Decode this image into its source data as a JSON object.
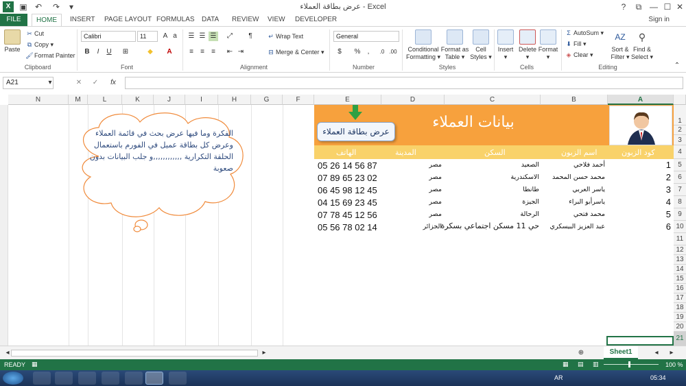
{
  "window": {
    "title": "عرض بطاقة العملاء - Excel",
    "controls": [
      "?",
      "⧉",
      "—",
      "☐",
      "✕"
    ]
  },
  "tabs": [
    "FILE",
    "HOME",
    "INSERT",
    "PAGE LAYOUT",
    "FORMULAS",
    "DATA",
    "REVIEW",
    "VIEW",
    "DEVELOPER"
  ],
  "signin": "Sign in",
  "ribbon": {
    "clipboard": {
      "paste": "Paste",
      "cut": "Cut",
      "copy": "Copy",
      "format_painter": "Format Painter",
      "label": "Clipboard"
    },
    "font": {
      "name": "Calibri",
      "size": "11",
      "label": "Font"
    },
    "alignment": {
      "wrap": "Wrap Text",
      "merge": "Merge & Center",
      "label": "Alignment"
    },
    "number": {
      "format": "General",
      "label": "Number"
    },
    "styles": {
      "conditional": "Conditional",
      "formatting": "Formatting",
      "format_as": "Format as",
      "table": "Table",
      "cell": "Cell",
      "cell_styles": "Styles",
      "label": "Styles"
    },
    "cells": {
      "insert": "Insert",
      "delete": "Delete",
      "format": "Format",
      "label": "Cells"
    },
    "editing": {
      "autosum": "AutoSum",
      "fill": "Fill",
      "clear": "Clear",
      "sort": "Sort &",
      "filter": "Filter",
      "find": "Find &",
      "select": "Select",
      "label": "Editing"
    }
  },
  "formula_bar": {
    "name_box": "A21",
    "fx": "fx"
  },
  "columns": [
    "N",
    "M",
    "L",
    "K",
    "J",
    "I",
    "H",
    "G",
    "F",
    "E",
    "D",
    "C",
    "B",
    "A"
  ],
  "rows": [
    "1",
    "2",
    "3",
    "4",
    "5",
    "6",
    "7",
    "8",
    "9",
    "10",
    "11",
    "12",
    "13",
    "14",
    "15",
    "16",
    "17",
    "18",
    "19",
    "20",
    "21"
  ],
  "sheet": {
    "title": "بيانات العملاء",
    "button": "عرض بطاقة العملاء",
    "headers": {
      "id": "كود الزبون",
      "name": "اسم الزبون",
      "address": "السكن",
      "city": "المدينة",
      "phone": "الهاتف"
    },
    "records": [
      {
        "id": "1",
        "name": "أحمد فلاحي",
        "address": "الصعيد",
        "city": "مصر",
        "phone": "05 26 14 56 87"
      },
      {
        "id": "2",
        "name": "محمد حسن المحمد",
        "address": "الاسكندرية",
        "city": "مصر",
        "phone": "07 89 65 23 02"
      },
      {
        "id": "3",
        "name": "ياسر العربي",
        "address": "طانطا",
        "city": "مصر",
        "phone": "06 45 98 12 45"
      },
      {
        "id": "4",
        "name": "ياسرأبو البراء",
        "address": "الجيزة",
        "city": "مصر",
        "phone": "04 15 69 23 45"
      },
      {
        "id": "5",
        "name": "محمد فتحي",
        "address": "الرحالة",
        "city": "مصر",
        "phone": "07 78 45 12 56"
      },
      {
        "id": "6",
        "name": "عبد العزيز البيسكري",
        "address": "حي 11 مسكن اجتماعي بسكرة",
        "city": "الجزائر",
        "phone": "05 56 78 02 14"
      }
    ],
    "cloud_text": "الفكرة وما فيها عرض بحث في قائمة العملاء وعرض كل بطاقة عميل في الفورم باستعمال الحلقة التكرارية ,,,,,,,,,,,,و جلب البيانات بدون صعوبة"
  },
  "sheet_tab": "Sheet1",
  "status": {
    "ready": "READY",
    "zoom": "100 %"
  },
  "taskbar": {
    "lang": "AR",
    "time": "05:34"
  },
  "colors": {
    "accent": "#217346",
    "header_orange": "#f7a13d",
    "header_yellow": "#f9d26a"
  }
}
